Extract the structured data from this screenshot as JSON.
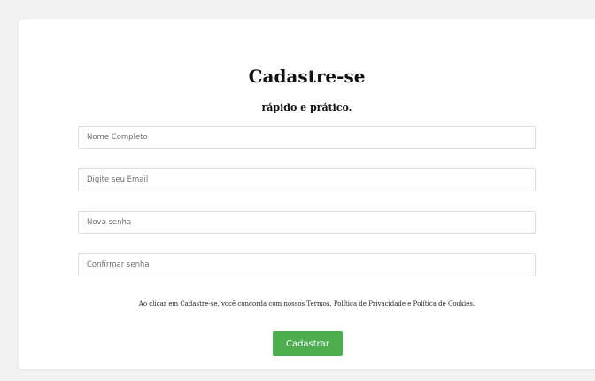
{
  "form": {
    "title": "Cadastre-se",
    "subtitle": "rápido e prático.",
    "fields": [
      {
        "placeholder": "Nome Completo",
        "value": ""
      },
      {
        "placeholder": "Digite seu Email",
        "value": ""
      },
      {
        "placeholder": "Nova senha",
        "value": ""
      },
      {
        "placeholder": "Confirmar senha",
        "value": ""
      }
    ],
    "terms": "Ao clicar em Cadastre-se, você concorda com nossos Termos, Política de Privacidade e Política de Cookies.",
    "submit_label": "Cadastrar"
  },
  "colors": {
    "background": "#f2f2f2",
    "card": "#ffffff",
    "submit_button": "#4cae4f",
    "border": "#dddddd"
  }
}
